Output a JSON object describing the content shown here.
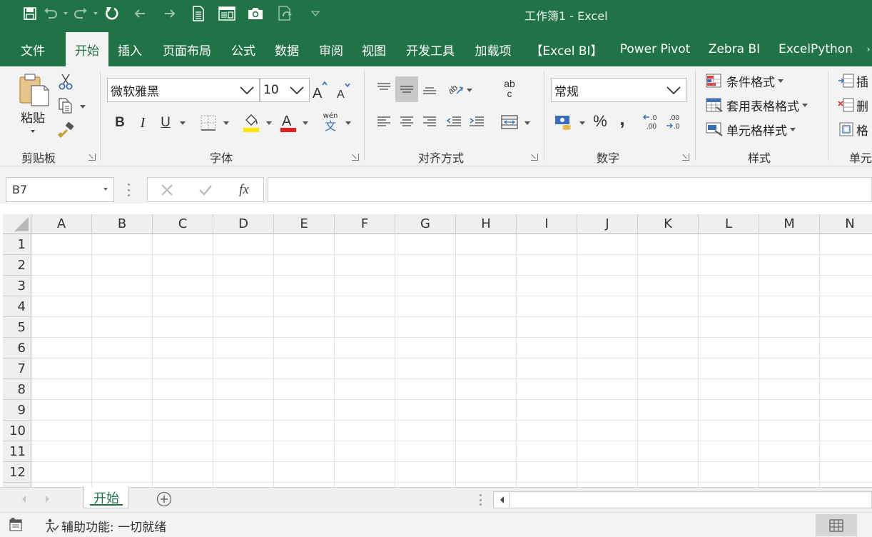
{
  "window": {
    "title": "工作簿1  -  Excel"
  },
  "qat": {
    "items": [
      "save-icon",
      "undo-icon",
      "redo-icon",
      "refresh-icon",
      "back-icon",
      "forward-icon",
      "document-icon",
      "window-icon",
      "camera-icon",
      "sync-icon",
      "customize-icon"
    ]
  },
  "tabs": [
    {
      "label": "文件",
      "active": false
    },
    {
      "label": "开始",
      "active": true
    },
    {
      "label": "插入",
      "active": false
    },
    {
      "label": "页面布局",
      "active": false
    },
    {
      "label": "公式",
      "active": false
    },
    {
      "label": "数据",
      "active": false
    },
    {
      "label": "审阅",
      "active": false
    },
    {
      "label": "视图",
      "active": false
    },
    {
      "label": "开发工具",
      "active": false
    },
    {
      "label": "加载项",
      "active": false
    },
    {
      "label": "【Excel BI】",
      "active": false
    },
    {
      "label": "Power Pivot",
      "active": false
    },
    {
      "label": "Zebra BI",
      "active": false
    },
    {
      "label": "ExcelPython",
      "active": false
    }
  ],
  "ribbon": {
    "clipboard": {
      "label": "剪贴板",
      "paste_label": "粘贴"
    },
    "font": {
      "label": "字体",
      "font_name": "微软雅黑",
      "font_size": "10",
      "bold": "B",
      "italic": "I",
      "underline": "U",
      "phonetic_top": "wén",
      "phonetic_bottom": "文"
    },
    "alignment": {
      "label": "对齐方式",
      "wrap_top": "ab",
      "wrap_bottom": "c"
    },
    "number": {
      "label": "数字",
      "format": "常规",
      "percent": "%",
      "comma": ","
    },
    "styles": {
      "label": "样式",
      "conditional": "条件格式",
      "table": "套用表格格式",
      "cell": "单元格样式"
    },
    "cells": {
      "label": "单元",
      "insert": "插",
      "delete": "删",
      "format": "格"
    }
  },
  "formula_bar": {
    "name_box": "B7",
    "fx": "fx",
    "value": ""
  },
  "grid": {
    "columns": [
      "A",
      "B",
      "C",
      "D",
      "E",
      "F",
      "G",
      "H",
      "I",
      "J",
      "K",
      "L",
      "M",
      "N"
    ],
    "rows": [
      "1",
      "2",
      "3",
      "4",
      "5",
      "6",
      "7",
      "8",
      "9",
      "10",
      "11",
      "12"
    ]
  },
  "sheets": {
    "active": "开始"
  },
  "status": {
    "text": "辅助功能: 一切就绪"
  },
  "colors": {
    "brand": "#217346",
    "font_color_bar": "#e02020",
    "fill_color_bar": "#ffe600"
  }
}
